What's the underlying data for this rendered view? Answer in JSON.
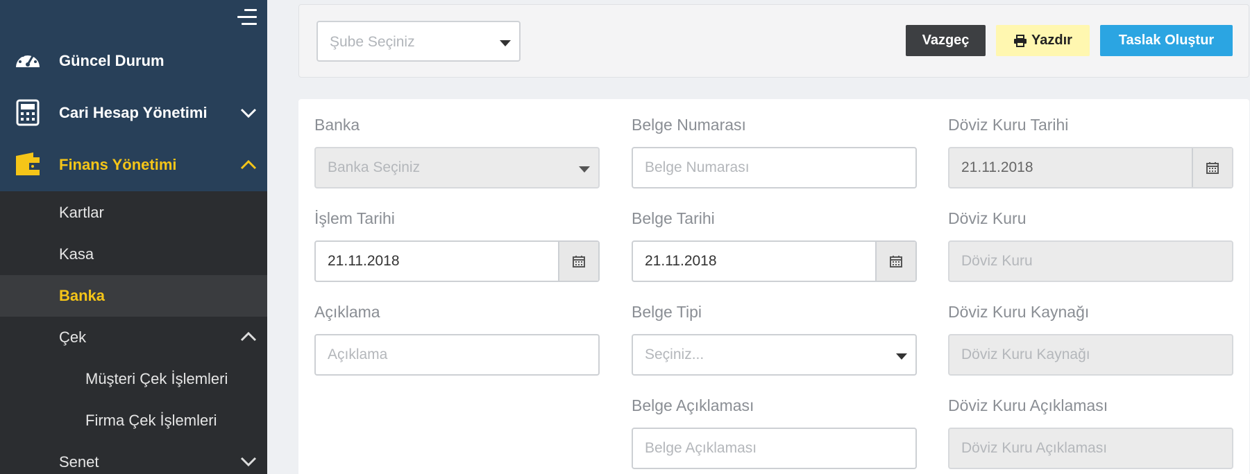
{
  "sidebar": {
    "menu": [
      {
        "label": "Güncel Durum",
        "icon": "dashboard-icon"
      },
      {
        "label": "Cari Hesap Yönetimi",
        "icon": "calculator-icon"
      },
      {
        "label": "Finans Yönetimi",
        "icon": "wallet-icon"
      }
    ],
    "submenu": [
      {
        "label": "Kartlar"
      },
      {
        "label": "Kasa"
      },
      {
        "label": "Banka"
      },
      {
        "label": "Çek"
      },
      {
        "label": "Müşteri Çek İşlemleri"
      },
      {
        "label": "Firma Çek İşlemleri"
      },
      {
        "label": "Senet"
      }
    ]
  },
  "topbar": {
    "branch_placeholder": "Şube Seçiniz",
    "cancel_label": "Vazgeç",
    "print_label": "Yazdır",
    "draft_label": "Taslak Oluştur"
  },
  "form": {
    "bank_label": "Banka",
    "bank_placeholder": "Banka Seçiniz",
    "doc_no_label": "Belge Numarası",
    "doc_no_placeholder": "Belge Numarası",
    "fx_date_label": "Döviz Kuru Tarihi",
    "fx_date_value": "21.11.2018",
    "txn_date_label": "İşlem Tarihi",
    "txn_date_value": "21.11.2018",
    "doc_date_label": "Belge Tarihi",
    "doc_date_value": "21.11.2018",
    "fx_rate_label": "Döviz Kuru",
    "fx_rate_placeholder": "Döviz Kuru",
    "desc_label": "Açıklama",
    "desc_placeholder": "Açıklama",
    "doc_type_label": "Belge Tipi",
    "doc_type_placeholder": "Seçiniz...",
    "fx_source_label": "Döviz Kuru Kaynağı",
    "fx_source_placeholder": "Döviz Kuru Kaynağı",
    "doc_desc_label": "Belge Açıklaması",
    "doc_desc_placeholder": "Belge Açıklaması",
    "fx_desc_label": "Döviz Kuru Açıklaması",
    "fx_desc_placeholder": "Döviz Kuru Açıklaması"
  },
  "colors": {
    "sidebar_top": "#284059",
    "sidebar_bottom": "#2b2d30",
    "accent_yellow": "#f5c518",
    "button_blue": "#2ba5e2",
    "button_dark": "#3d3f42",
    "button_print": "#fff7b0"
  }
}
